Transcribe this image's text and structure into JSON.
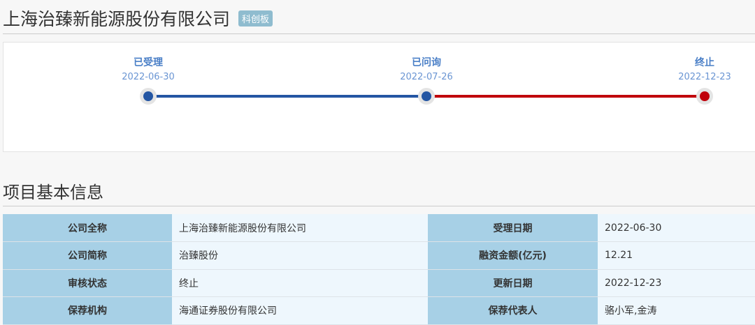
{
  "header": {
    "title": "上海治臻新能源股份有限公司",
    "badge": "科创板"
  },
  "timeline": [
    {
      "label": "已受理",
      "date": "2022-06-30",
      "color": "#2456a3"
    },
    {
      "label": "已问询",
      "date": "2022-07-26",
      "color": "#2456a3"
    },
    {
      "label": "终止",
      "date": "2022-12-23",
      "color": "#c0000b"
    }
  ],
  "section": {
    "title": "项目基本信息"
  },
  "info": {
    "rows": [
      {
        "k1": "公司全称",
        "v1": "上海治臻新能源股份有限公司",
        "k2": "受理日期",
        "v2": "2022-06-30"
      },
      {
        "k1": "公司简称",
        "v1": "治臻股份",
        "k2": "融资金额(亿元)",
        "v2": "12.21"
      },
      {
        "k1": "审核状态",
        "v1": "终止",
        "k2": "更新日期",
        "v2": "2022-12-23"
      },
      {
        "k1": "保荐机构",
        "v1": "海通证券股份有限公司",
        "k2": "保荐代表人",
        "v2": "骆小军,金涛"
      }
    ]
  }
}
